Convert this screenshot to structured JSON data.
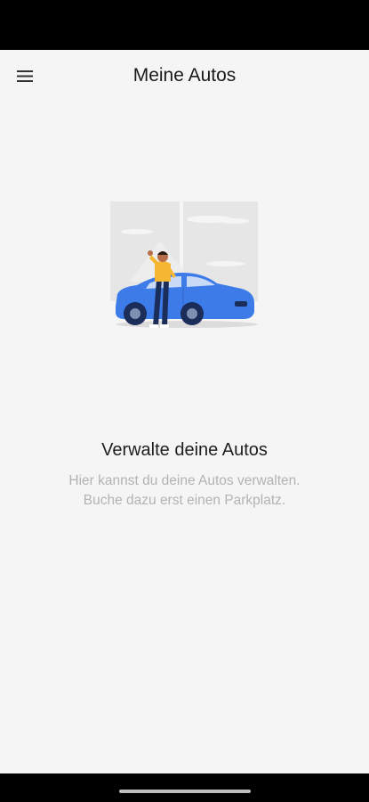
{
  "app_bar": {
    "title": "Meine Autos",
    "menu_icon": "hamburger-menu-icon"
  },
  "illustration": {
    "name": "person-with-car-illustration",
    "car_color": "#3d7be8",
    "shirt_color": "#f5b731"
  },
  "empty_state": {
    "title": "Verwalte deine Autos",
    "description_line1": "Hier kannst du deine Autos verwalten.",
    "description_line2": "Buche dazu erst einen Parkplatz."
  },
  "colors": {
    "background": "#f5f5f5",
    "system_bars": "#000000",
    "text_primary": "#1f1f1f",
    "text_secondary": "#b3b3b3"
  }
}
